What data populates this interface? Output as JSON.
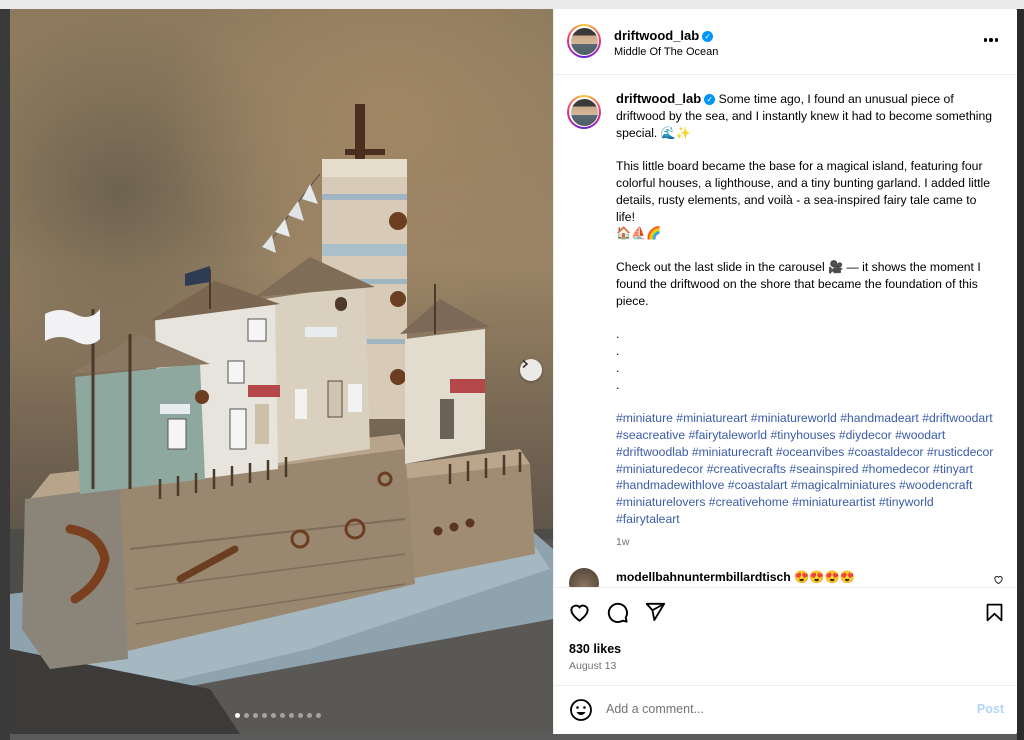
{
  "post": {
    "username": "driftwood_lab",
    "location": "Middle Of The Ocean",
    "verified_glyph": "✓"
  },
  "caption": {
    "username": "driftwood_lab",
    "intro": "Some time ago, I found an unusual piece of driftwood by the sea, and I instantly knew it had to become something special. 🌊✨",
    "paragraph2": "This little board became the base for a magical island, featuring four colorful houses, a lighthouse, and a tiny bunting garland. I added little details, rusty elements, and voilà - a sea-inspired fairy tale came to life!",
    "emoji_line": "🏠⛵🌈",
    "paragraph3": "Check out the last slide in the carousel 🎥 — it shows the moment I found the driftwood on the shore that became the foundation of this piece.",
    "dots": [
      ".",
      ".",
      ".",
      "."
    ],
    "hashtags": "#miniature #miniatureart #miniatureworld #handmadeart #driftwoodart #seacreative #fairytaleworld #tinyhouses #diydecor #woodart #driftwoodlab #miniaturecraft #oceanvibes #coastaldecor #rusticdecor #miniaturedecor #creativecrafts #seainspired #homedecor #tinyart #handmadewithlove #coastalart #magicalminiatures #woodencraft #miniaturelovers #creativehome #miniatureartist #tinyworld #fairytaleart",
    "time_ago": "1w"
  },
  "comment": {
    "username": "modellbahnuntermbillardtisch",
    "text": "😍😍😍😍"
  },
  "engagement": {
    "likes": "830 likes",
    "date": "August 13"
  },
  "add_comment": {
    "placeholder": "Add a comment...",
    "post_label": "Post"
  },
  "carousel": {
    "slide_count": 10,
    "active_index": 0
  },
  "icons": [
    "like-icon",
    "comment-icon",
    "share-icon",
    "save-icon",
    "emoji-icon",
    "more-icon",
    "chevron-right-icon",
    "heart-small-icon"
  ],
  "colors": {
    "hashtag": "#3b5ca8",
    "verified": "#0095f6",
    "post_disabled": "#b3d4fc",
    "meta": "#737373"
  }
}
